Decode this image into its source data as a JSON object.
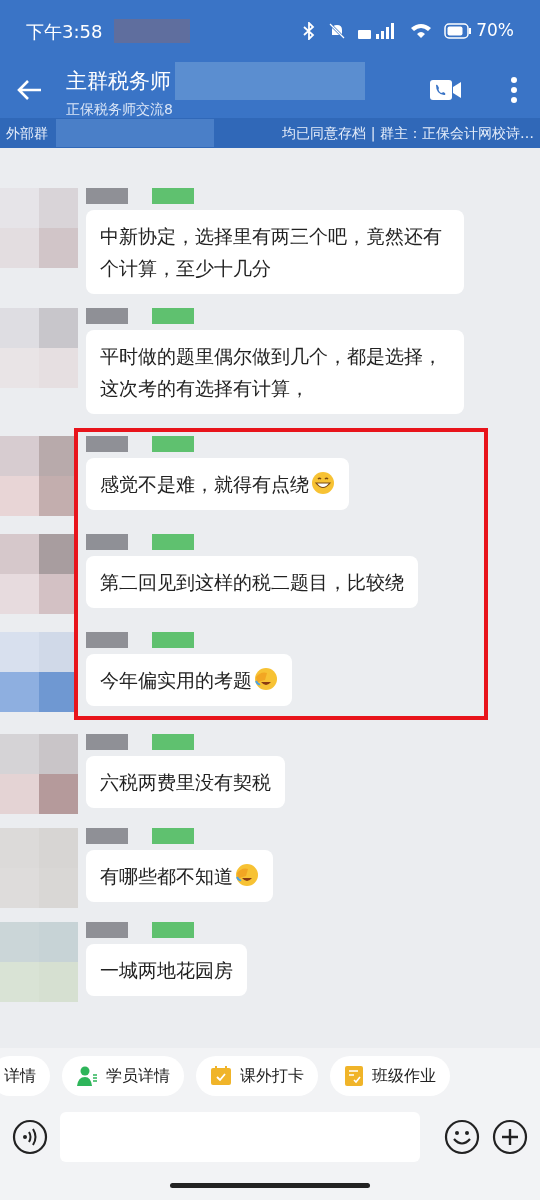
{
  "status_bar": {
    "time": "下午3:58",
    "battery": "70%"
  },
  "header": {
    "title": "主群税务师",
    "subtitle": "正保税务师交流8"
  },
  "info_bar": {
    "left": "外部群",
    "right": "均已同意存档 | 群主：正保会计网校诗…"
  },
  "message_groups": [
    {
      "highlighted": false,
      "messages": [
        {
          "kind": "plain",
          "text": "中新协定，选择里有两三个吧，竟然还有个计算，至少十几分"
        },
        {
          "kind": "plain",
          "text": "平时做的题里偶尔做到几个，都是选择，这次考的有选择有计算，"
        }
      ]
    },
    {
      "highlighted": true,
      "messages": [
        {
          "kind": "grin",
          "text": "感觉不是难，就得有点绕"
        },
        {
          "kind": "plain",
          "text": "第二回见到这样的税二题目，比较绕"
        },
        {
          "kind": "facepalm",
          "text": "今年偏实用的考题"
        }
      ]
    },
    {
      "highlighted": false,
      "messages": [
        {
          "kind": "plain",
          "text": "六税两费里没有契税"
        },
        {
          "kind": "facepalm",
          "text": "有哪些都不知道"
        },
        {
          "kind": "plain",
          "text": "一城两地花园房"
        }
      ]
    }
  ],
  "quick_actions": [
    {
      "kind": "plain",
      "label": "详情"
    },
    {
      "kind": "person",
      "label": "学员详情"
    },
    {
      "kind": "calendar",
      "label": "课外打卡"
    },
    {
      "kind": "note",
      "label": "班级作业"
    }
  ]
}
